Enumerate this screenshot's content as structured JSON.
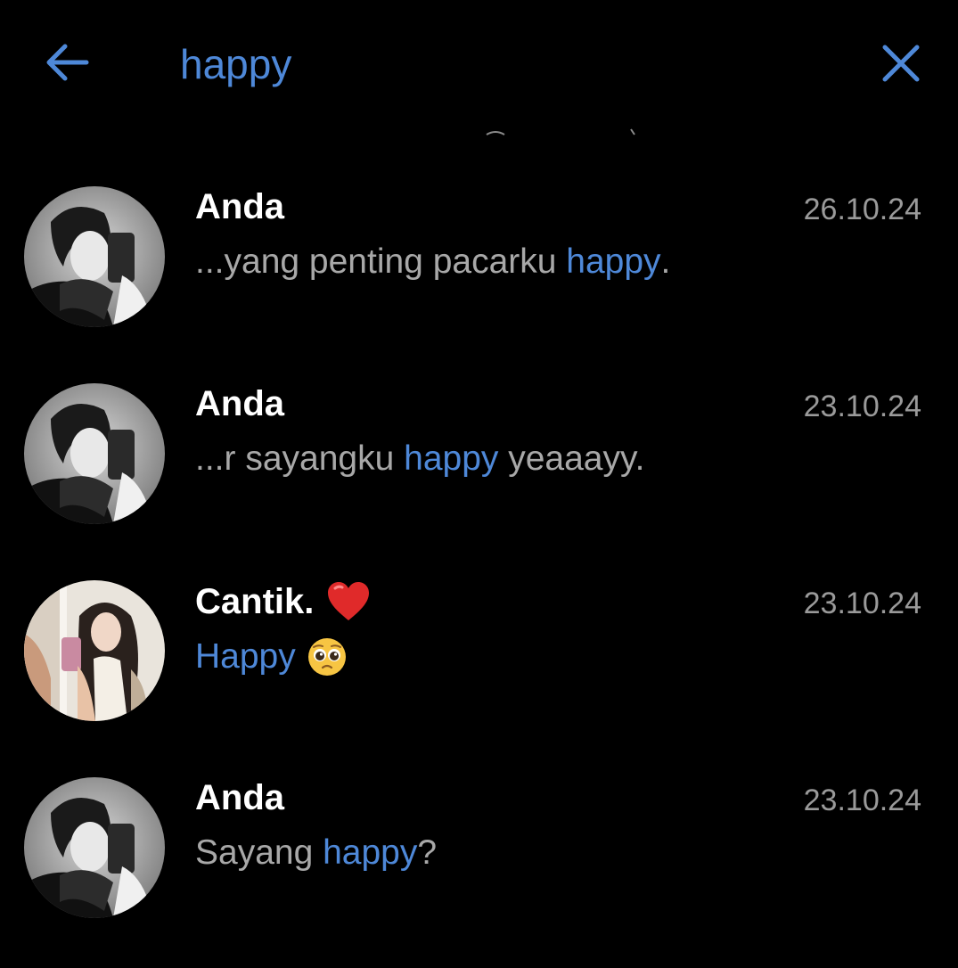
{
  "search": {
    "query": "happy",
    "back_icon": "arrow-left-icon",
    "close_icon": "close-icon"
  },
  "colors": {
    "background": "#000000",
    "accent": "#4e88d8",
    "name": "#ffffff",
    "snippet": "#a8a8a8",
    "date": "#9a9a9a"
  },
  "results": [
    {
      "name": "Anda",
      "date": "26.10.24",
      "snippet_before": "...yang penting pacarku ",
      "snippet_match": "happy",
      "snippet_after": "."
    },
    {
      "name": "Anda",
      "date": "23.10.24",
      "snippet_before": "...r sayangku ",
      "snippet_match": "happy",
      "snippet_after": " yeaaayy."
    },
    {
      "name": "Cantik.",
      "name_icon": "red-heart-icon",
      "date": "23.10.24",
      "snippet_before": "",
      "snippet_match": "Happy",
      "snippet_after": "",
      "snippet_icon": "pleading-face-icon"
    },
    {
      "name": "Anda",
      "date": "23.10.24",
      "snippet_before": "Sayang ",
      "snippet_match": "happy",
      "snippet_after": "?"
    }
  ]
}
